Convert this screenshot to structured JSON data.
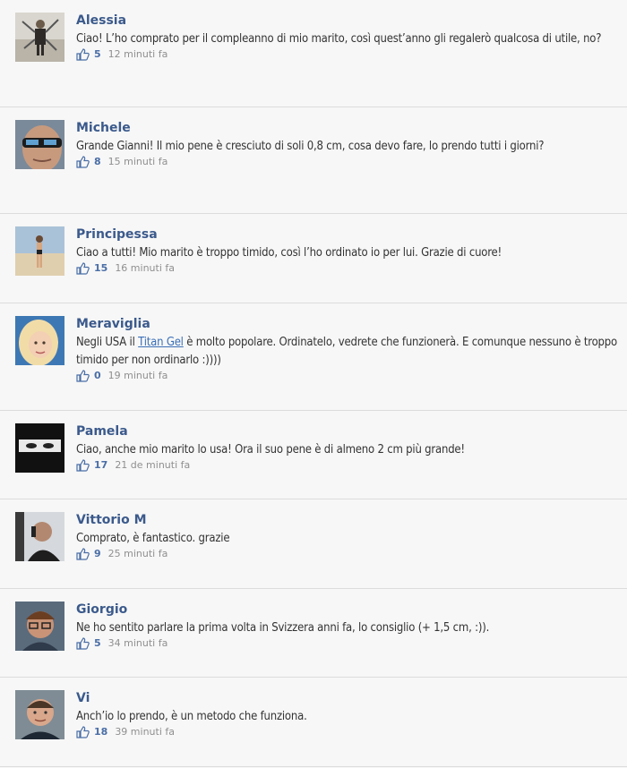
{
  "comments": [
    {
      "name": "Alessia",
      "text": "Ciao! L’ho comprato per il compleanno di mio marito, così quest’anno gli regalerò qualcosa di utile, no?",
      "likes": "5",
      "time": "12 minuti fa",
      "avatar": "person-standing-icon"
    },
    {
      "name": "Michele",
      "text": "Grande Gianni! Il mio pene è cresciuto di soli 0,8 cm, cosa devo fare, lo prendo tutti i giorni?",
      "likes": "8",
      "time": "15 minuti fa",
      "avatar": "man-sunglasses-icon"
    },
    {
      "name": "Principessa",
      "text": "Ciao a tutti! Mio marito è troppo timido, così l’ho ordinato io per lui. Grazie di cuore!",
      "likes": "15",
      "time": "16 minuti fa",
      "avatar": "woman-beach-icon"
    },
    {
      "name": "Meraviglia",
      "text_before": "Negli USA il ",
      "link": "Titan Gel",
      "text_after": " è molto popolare. Ordinatelo, vedrete che funzionerà. E comunque nessuno è troppo timido per non ordinarlo :))))",
      "likes": "0",
      "time": "19 minuti fa",
      "avatar": "blonde-woman-icon"
    },
    {
      "name": "Pamela",
      "text": "Ciao, anche mio marito lo usa! Ora il suo pene è di almeno 2 cm più grande!",
      "likes": "17",
      "time": "21 de minuti fa",
      "avatar": "veiled-woman-icon"
    },
    {
      "name": "Vittorio M",
      "text": "Comprato, è fantastico. grazie",
      "likes": "9",
      "time": "25 minuti fa",
      "avatar": "man-phone-icon"
    },
    {
      "name": "Giorgio",
      "text": "Ne ho sentito parlare la prima volta in Svizzera anni fa, lo consiglio (+ 1,5 cm, :)).",
      "likes": "5",
      "time": "34 minuti fa",
      "avatar": "man-glasses-icon"
    },
    {
      "name": "Vi",
      "text": "Anch’io lo prendo, è un metodo che funziona.",
      "likes": "18",
      "time": "39 minuti fa",
      "avatar": "young-man-icon"
    }
  ],
  "colors": {
    "name": "#3b5a8c",
    "link": "#3b6fb6",
    "meta_time": "#8f8f8f",
    "like": "#4a6ea6"
  }
}
